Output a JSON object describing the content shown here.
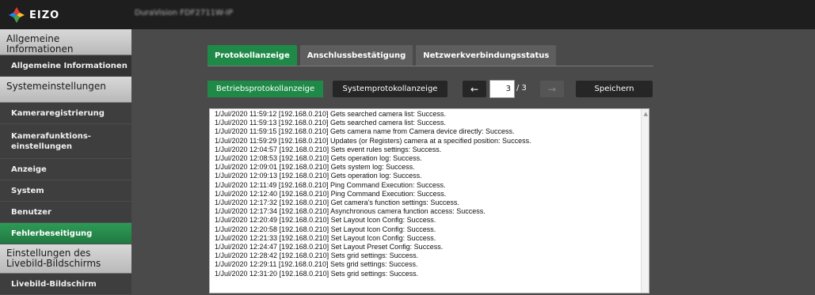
{
  "brand": {
    "logo_text": "EIZO",
    "device_name": "DuraVision FDF2711W-IP"
  },
  "sidebar": {
    "sections": [
      {
        "label": "Allgemeine Informationen",
        "items": [
          {
            "label": "Allgemeine Informationen"
          }
        ]
      },
      {
        "label": "Systemeinstellungen",
        "items": [
          {
            "label": "Kameraregistrierung"
          },
          {
            "label": "Kamerafunktions-einstellungen"
          },
          {
            "label": "Anzeige"
          },
          {
            "label": "System"
          },
          {
            "label": "Benutzer"
          },
          {
            "label": "Fehlerbeseitigung"
          }
        ]
      },
      {
        "label": "Einstellungen des Livebild-Bildschirms",
        "items": [
          {
            "label": "Livebild-Bildschirm"
          }
        ]
      }
    ],
    "active_item": "Fehlerbeseitigung"
  },
  "tabs": [
    {
      "label": "Protokollanzeige",
      "active": true
    },
    {
      "label": "Anschlussbestätigung",
      "active": false
    },
    {
      "label": "Netzwerkverbindungsstatus",
      "active": false
    }
  ],
  "toolbar": {
    "operation_log_label": "Betriebsprotokollanzeige",
    "system_log_label": "Systemprotokollanzeige",
    "prev_label": "←",
    "page_value": "3",
    "page_total": "/ 3",
    "next_label": "→",
    "save_label": "Speichern"
  },
  "log_lines": [
    "1/Jul/2020 11:59:12  [192.168.0.210] Gets searched camera list: Success.",
    "1/Jul/2020 11:59:13  [192.168.0.210] Gets searched camera list: Success.",
    "1/Jul/2020 11:59:15  [192.168.0.210] Gets camera name from Camera device directly: Success.",
    "1/Jul/2020 11:59:29  [192.168.0.210] Updates (or Registers) camera at a specified position: Success.",
    "1/Jul/2020 12:04:57  [192.168.0.210] Sets event rules settings: Success.",
    "1/Jul/2020 12:08:53  [192.168.0.210] Gets operation log: Success.",
    "1/Jul/2020 12:09:01  [192.168.0.210] Gets system log: Success.",
    "1/Jul/2020 12:09:13  [192.168.0.210] Gets operation log: Success.",
    "1/Jul/2020 12:11:49  [192.168.0.210] Ping Command Execution: Success.",
    "1/Jul/2020 12:12:40  [192.168.0.210] Ping Command Execution: Success.",
    "1/Jul/2020 12:17:32  [192.168.0.210] Get camera's function settings: Success.",
    "1/Jul/2020 12:17:34  [192.168.0.210] Asynchronous camera function access: Success.",
    "1/Jul/2020 12:20:49  [192.168.0.210] Set Layout Icon Config: Success.",
    "1/Jul/2020 12:20:58  [192.168.0.210] Set Layout Icon Config: Success.",
    "1/Jul/2020 12:21:33  [192.168.0.210] Set Layout Icon Config: Success.",
    "1/Jul/2020 12:24:47  [192.168.0.210] Set Layout Preset Config: Success.",
    "1/Jul/2020 12:28:42  [192.168.0.210] Sets grid settings: Success.",
    "1/Jul/2020 12:29:11  [192.168.0.210] Sets grid settings: Success.",
    "1/Jul/2020 12:31:20  [192.168.0.210] Sets grid settings: Success."
  ],
  "colors": {
    "accent": "#1f8a48",
    "topbar": "#1e1e1e",
    "background": "#4a4a4a"
  }
}
